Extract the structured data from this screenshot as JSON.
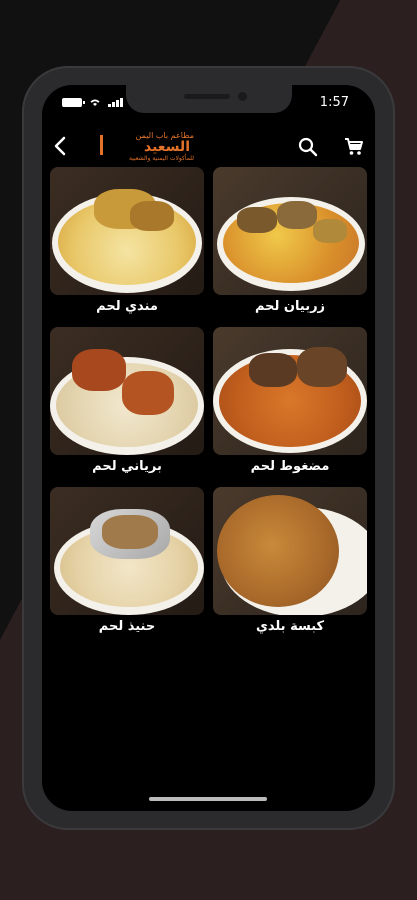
{
  "status": {
    "time": "1:57"
  },
  "header": {
    "logo": {
      "line1": "مطاعم باب اليمن",
      "line2": "السعيد",
      "line3": "للمأكولات اليمنية والشعبية"
    }
  },
  "icons": {
    "back": "chevron-left-icon",
    "search": "search-icon",
    "cart": "cart-icon"
  },
  "colors": {
    "accent": "#e4732a",
    "background": "#000000"
  },
  "menu": {
    "items": [
      {
        "label": "زربيان لحم"
      },
      {
        "label": "مندي لحم"
      },
      {
        "label": "مضغوط لحم"
      },
      {
        "label": "برياني لحم"
      },
      {
        "label": "كبسة بلدي"
      },
      {
        "label": "حنيذ لحم"
      }
    ]
  }
}
